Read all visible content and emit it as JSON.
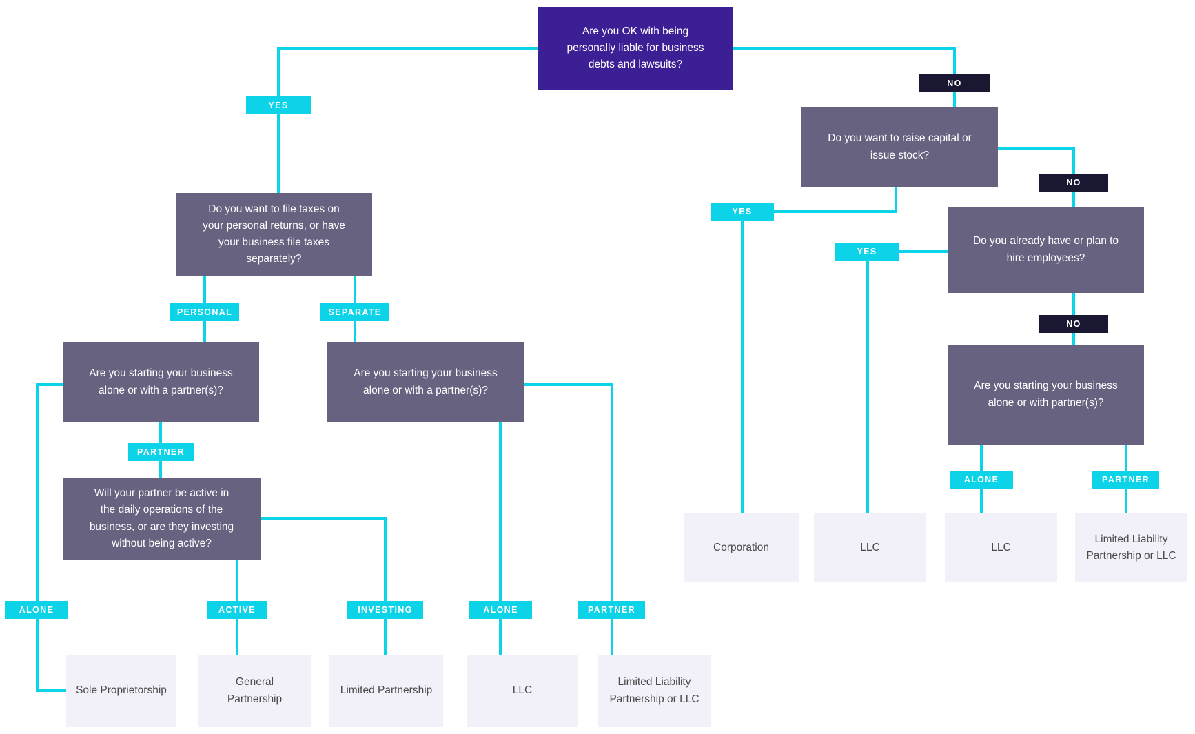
{
  "diagram": {
    "title": "Business Entity Structure Decision Flowchart",
    "colors": {
      "root_node": "#3d1f95",
      "question_node": "#676280",
      "result_node": "#f2f1fa",
      "result_text": "#4a4a4a",
      "connector": "#0dd3e8",
      "pill_yes": "#0dd3e8",
      "pill_no": "#1a1733",
      "background": "#ffffff"
    },
    "nodes": [
      {
        "id": "root",
        "kind": "root",
        "text": "Are you OK with being\npersonally liable for business\ndebts and lawsuits?"
      },
      {
        "id": "q_taxes",
        "kind": "question",
        "text": "Do you want to file taxes on\nyour personal returns, or have\nyour business file taxes\nseparately?"
      },
      {
        "id": "q_alone_personal",
        "kind": "question",
        "text": "Are you starting your business\nalone or with a partner(s)?"
      },
      {
        "id": "q_alone_separate",
        "kind": "question",
        "text": "Are you starting your business\nalone or with a partner(s)?"
      },
      {
        "id": "q_partner_active",
        "kind": "question",
        "text": "Will your partner be active in\nthe daily operations of the\nbusiness, or are they investing\nwithout being active?"
      },
      {
        "id": "q_capital",
        "kind": "question",
        "text": "Do you want to raise capital or\nissue stock?"
      },
      {
        "id": "q_employees",
        "kind": "question",
        "text": "Do you already have or plan to\nhire employees?"
      },
      {
        "id": "q_alone_right",
        "kind": "question",
        "text": "Are you starting your business\nalone or with partner(s)?"
      },
      {
        "id": "r_sole_prop",
        "kind": "result",
        "text": "Sole Proprietorship"
      },
      {
        "id": "r_general_partnership",
        "kind": "result",
        "text": "General Partnership"
      },
      {
        "id": "r_limited_partnership",
        "kind": "result",
        "text": "Limited Partnership"
      },
      {
        "id": "r_llc_separate",
        "kind": "result",
        "text": "LLC"
      },
      {
        "id": "r_llp_or_llc_left",
        "kind": "result",
        "text": "Limited Liability\nPartnership or LLC"
      },
      {
        "id": "r_corporation",
        "kind": "result",
        "text": "Corporation"
      },
      {
        "id": "r_llc_employees",
        "kind": "result",
        "text": "LLC"
      },
      {
        "id": "r_llc_alone",
        "kind": "result",
        "text": "LLC"
      },
      {
        "id": "r_llp_or_llc_right",
        "kind": "result",
        "text": "Limited Liability\nPartnership or LLC"
      }
    ],
    "edge_labels": [
      {
        "id": "lbl_yes_root",
        "text": "YES",
        "kind": "yes"
      },
      {
        "id": "lbl_no_root",
        "text": "NO",
        "kind": "no"
      },
      {
        "id": "lbl_personal",
        "text": "PERSONAL",
        "kind": "choice"
      },
      {
        "id": "lbl_separate",
        "text": "SEPARATE",
        "kind": "choice"
      },
      {
        "id": "lbl_partner_left",
        "text": "PARTNER",
        "kind": "choice"
      },
      {
        "id": "lbl_alone_far_left",
        "text": "ALONE",
        "kind": "choice"
      },
      {
        "id": "lbl_active",
        "text": "ACTIVE",
        "kind": "choice"
      },
      {
        "id": "lbl_investing",
        "text": "INVESTING",
        "kind": "choice"
      },
      {
        "id": "lbl_alone_mid",
        "text": "ALONE",
        "kind": "choice"
      },
      {
        "id": "lbl_partner_mid",
        "text": "PARTNER",
        "kind": "choice"
      },
      {
        "id": "lbl_yes_capital",
        "text": "YES",
        "kind": "yes"
      },
      {
        "id": "lbl_no_capital",
        "text": "NO",
        "kind": "no"
      },
      {
        "id": "lbl_yes_employees",
        "text": "YES",
        "kind": "yes"
      },
      {
        "id": "lbl_no_employees",
        "text": "NO",
        "kind": "no"
      },
      {
        "id": "lbl_alone_right",
        "text": "ALONE",
        "kind": "choice"
      },
      {
        "id": "lbl_partner_right",
        "text": "PARTNER",
        "kind": "choice"
      }
    ]
  }
}
